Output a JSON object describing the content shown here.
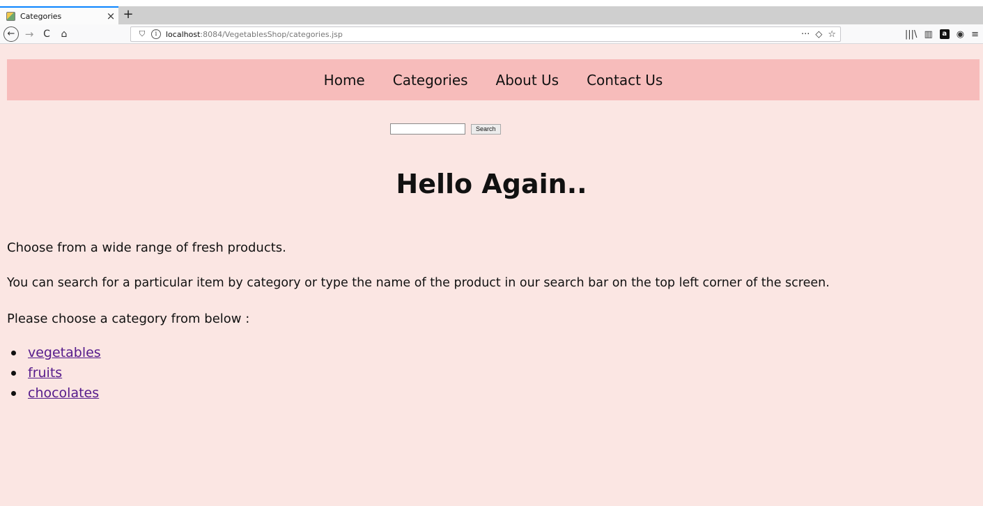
{
  "browser": {
    "tab": {
      "title": "Categories",
      "close": "×"
    },
    "new_tab": "+",
    "nav": {
      "back": "←",
      "forward": "→",
      "reload": "C",
      "home": "⌂"
    },
    "url": {
      "host": "localhost",
      "rest": ":8084/VegetablesShop/categories.jsp"
    },
    "url_actions": {
      "more": "···",
      "pocket": "◇",
      "bookmark": "☆"
    },
    "toolbar": {
      "library": "|||\\",
      "sidebar": "▥",
      "amazon": "a",
      "account": "◉",
      "menu": "≡"
    }
  },
  "site_nav": {
    "items": [
      "Home",
      "Categories",
      "About Us",
      "Contact Us"
    ]
  },
  "search": {
    "value": "",
    "button_label": "Search"
  },
  "heading": "Hello Again..",
  "paragraphs": [
    "Choose from a wide range of fresh products.",
    "You can search for a particular item by category or type the name of the product in our search bar on the top left corner of the screen.",
    "Please choose a category from below :"
  ],
  "categories": [
    "vegetables",
    "fruits",
    "chocolates"
  ],
  "colors": {
    "page_background": "#fbe6e3",
    "nav_background": "#f7bcbb",
    "link": "#551a8b"
  }
}
